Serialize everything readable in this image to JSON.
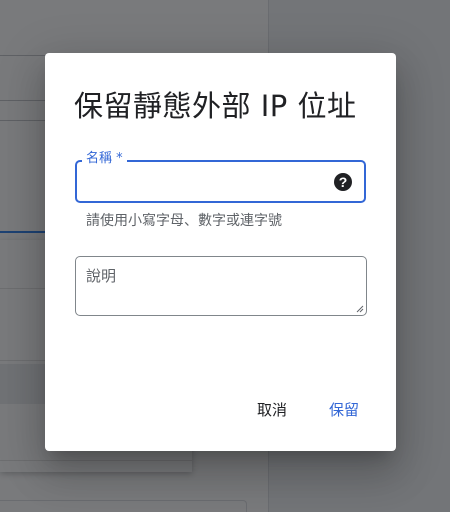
{
  "dialog": {
    "title": "保留靜態外部 IP 位址",
    "name_field": {
      "label": "名稱 *",
      "value": "",
      "hint": "請使用小寫字母、數字或連字號",
      "help_icon": "help-icon"
    },
    "description_field": {
      "placeholder": "說明",
      "value": ""
    },
    "actions": {
      "cancel_label": "取消",
      "save_label": "保留"
    }
  },
  "colors": {
    "accent": "#3367d6",
    "scrim": "rgba(32,33,36,0.6)",
    "text_primary": "#202124",
    "text_secondary": "#5f6368"
  }
}
